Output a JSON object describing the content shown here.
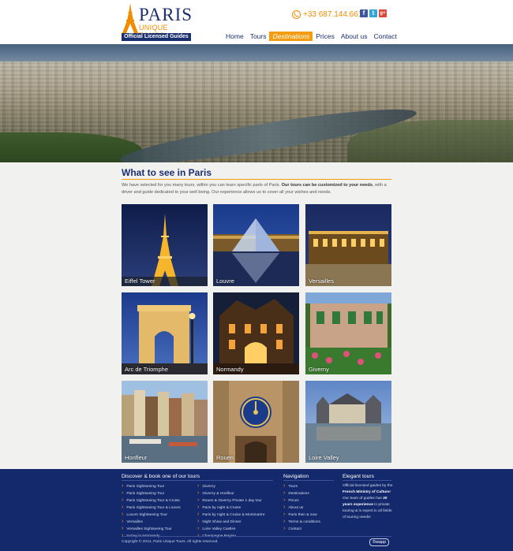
{
  "header": {
    "logo": {
      "title": "PARIS",
      "subtitle": "UNIQUE TOURS",
      "badge": "Official Licensed Guides"
    },
    "phone": "+33 687.144.661",
    "social": [
      {
        "name": "facebook-icon",
        "glyph": "f",
        "color": "#3b5998"
      },
      {
        "name": "twitter-icon",
        "glyph": "t",
        "color": "#35a5d8"
      },
      {
        "name": "google-plus-icon",
        "glyph": "g+",
        "color": "#d64937"
      }
    ],
    "nav": [
      "Home",
      "Tours",
      "Destinations",
      "Prices",
      "About us",
      "Contact"
    ],
    "nav_active": "Destinations"
  },
  "main": {
    "title": "What to see in Paris",
    "intro_part1": "We have selected for you many tours, within you can learn specific parts of Paris. ",
    "intro_bold": "Our tours can be customized to your needs",
    "intro_part2": ", with a driver and guide dedicated to your well being. Our experience allows us to cover all your wishes and needs.",
    "destinations": [
      {
        "label": "Eiffel Tower",
        "art": "eiffel"
      },
      {
        "label": "Louvre",
        "art": "louvre"
      },
      {
        "label": "Versailles",
        "art": "versailles"
      },
      {
        "label": "Arc de Triomphe",
        "art": "arc"
      },
      {
        "label": "Normandy",
        "art": "normandy"
      },
      {
        "label": "Giverny",
        "art": "giverny"
      },
      {
        "label": "Honfleur",
        "art": "honfleur"
      },
      {
        "label": "Rouen",
        "art": "rouen"
      },
      {
        "label": "Loire Valley",
        "art": "loire"
      }
    ]
  },
  "footer": {
    "discover_title": "Discover & book one of our tours",
    "discover_col1": [
      "Paris Sightseeing Tour",
      "Paris Sightseeing Tour",
      "Paris Sightseeing Tour & Cruise",
      "Paris Sightseeing Tour & Louvre",
      "Louvre Sightseeing Tour",
      "Versailles",
      "Versailles Sightseeing Tour",
      "D-Day in Normandy"
    ],
    "discover_col2": [
      "Giverny",
      "Giverny & Honfleur",
      "Rouen & Giverny Private 1 day tour",
      "Paris by night & Cruise",
      "Paris by night & Cruise & Montmartre",
      "Night Show and Dinner",
      "Loire Valley Castles",
      "Champagne Region"
    ],
    "navigation_title": "Navigation",
    "navigation": [
      "Tours",
      "Destinations",
      "Prices",
      "About us",
      "Paris then & now",
      "Terms & conditions",
      "Contact"
    ],
    "elegant_title": "Elegant tours",
    "elegant_1": "Official licensed guides by the ",
    "elegant_2": "French Ministry of Culture",
    "elegant_3": "! Our team of guides has ",
    "elegant_4": "20 years experience",
    "elegant_5": " in private touring & is expert in all fields of touring needs!",
    "copyright": "Copyright © 2014, Paris Unique Tours. All rights reserved.",
    "credit": "©wapp"
  }
}
